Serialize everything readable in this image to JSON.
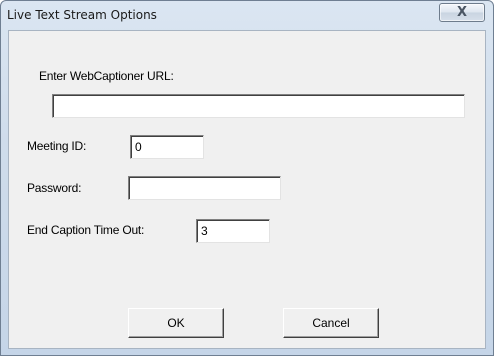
{
  "window": {
    "title": "Live Text Stream Options",
    "close_glyph": "X"
  },
  "form": {
    "url_label": "Enter WebCaptioner URL:",
    "url_value": "",
    "meeting_id_label": "Meeting ID:",
    "meeting_id_value": "0",
    "password_label": "Password:",
    "password_value": "",
    "timeout_label": "End Caption Time Out:",
    "timeout_value": "3"
  },
  "buttons": {
    "ok_label": "OK",
    "cancel_label": "Cancel"
  },
  "icons": {
    "close": "close-icon"
  },
  "colors": {
    "titlebar": "#cfdceb",
    "client": "#f0f0f0",
    "field": "#ffffff"
  }
}
